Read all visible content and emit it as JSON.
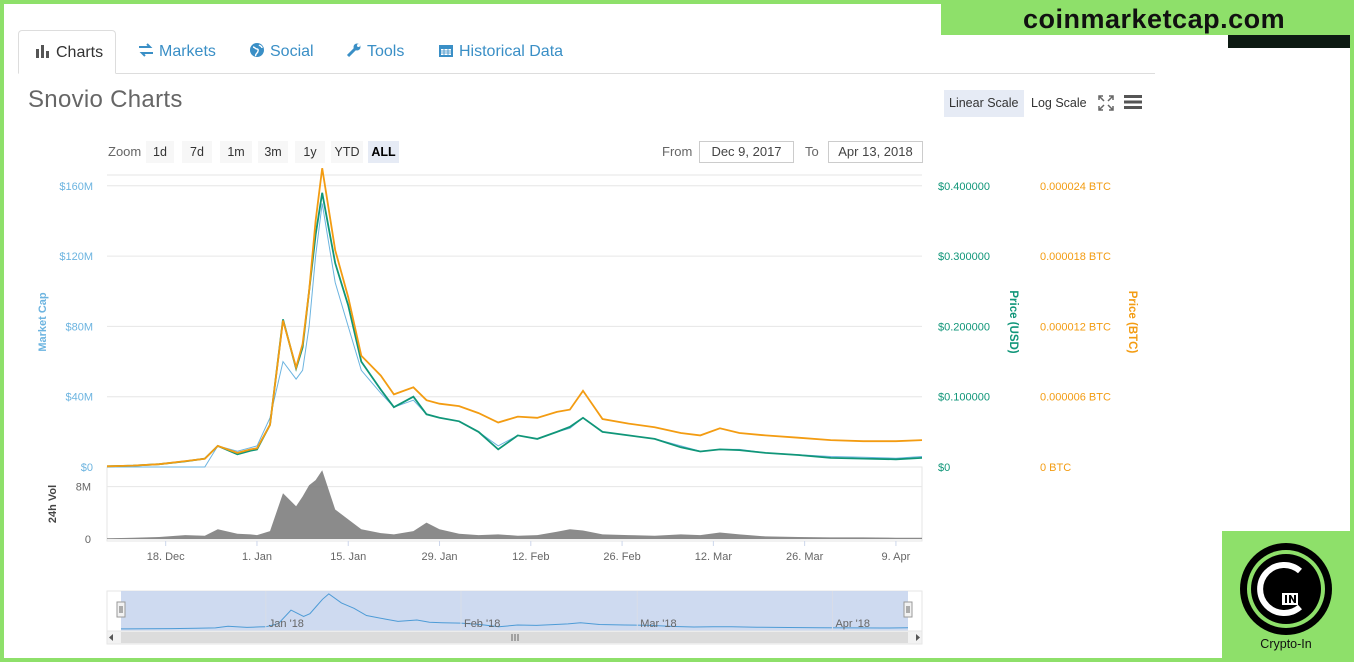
{
  "tabs": [
    {
      "label": "Charts",
      "icon": "bar-chart-icon",
      "active": true
    },
    {
      "label": "Markets",
      "icon": "exchange-arrows-icon",
      "active": false
    },
    {
      "label": "Social",
      "icon": "globe-icon",
      "active": false
    },
    {
      "label": "Tools",
      "icon": "wrench-icon",
      "active": false
    },
    {
      "label": "Historical Data",
      "icon": "calendar-icon",
      "active": false
    }
  ],
  "title": "Snovio Charts",
  "scale": {
    "linear_label": "Linear Scale",
    "log_label": "Log Scale",
    "selected": "linear"
  },
  "zoom": {
    "label": "Zoom",
    "buttons": [
      "1d",
      "7d",
      "1m",
      "3m",
      "1y",
      "YTD",
      "ALL"
    ],
    "selected": "ALL"
  },
  "range": {
    "from_label": "From",
    "from_value": "Dec 9, 2017",
    "to_label": "To",
    "to_value": "Apr 13, 2018"
  },
  "watermark": {
    "site": "coinmarketcap.com",
    "logo_caption": "Crypto-In"
  },
  "colors": {
    "market_cap": "#6cb4e0",
    "price_usd": "#109679",
    "price_btc": "#f39c12",
    "volume": "#777777",
    "navigator_fill": "#c9d6ee",
    "banner": "#8ee06a"
  },
  "chart_data": {
    "type": "line",
    "x": [
      "2017-12-09",
      "2017-12-13",
      "2017-12-17",
      "2017-12-21",
      "2017-12-24",
      "2017-12-26",
      "2017-12-29",
      "2017-12-31",
      "2018-01-01",
      "2018-01-03",
      "2018-01-05",
      "2018-01-07",
      "2018-01-08",
      "2018-01-09",
      "2018-01-10",
      "2018-01-11",
      "2018-01-13",
      "2018-01-15",
      "2018-01-17",
      "2018-01-20",
      "2018-01-22",
      "2018-01-25",
      "2018-01-27",
      "2018-01-29",
      "2018-02-01",
      "2018-02-04",
      "2018-02-07",
      "2018-02-10",
      "2018-02-13",
      "2018-02-16",
      "2018-02-18",
      "2018-02-20",
      "2018-02-23",
      "2018-02-27",
      "2018-03-03",
      "2018-03-07",
      "2018-03-10",
      "2018-03-13",
      "2018-03-16",
      "2018-03-20",
      "2018-03-25",
      "2018-03-30",
      "2018-04-04",
      "2018-04-09",
      "2018-04-13"
    ],
    "series": [
      {
        "name": "Price (USD)",
        "axis": "right-usd",
        "values": [
          0.001,
          0.002,
          0.004,
          0.008,
          0.012,
          0.03,
          0.018,
          0.023,
          0.025,
          0.06,
          0.21,
          0.14,
          0.17,
          0.25,
          0.33,
          0.39,
          0.29,
          0.23,
          0.15,
          0.11,
          0.085,
          0.1,
          0.075,
          0.07,
          0.065,
          0.05,
          0.025,
          0.045,
          0.04,
          0.05,
          0.057,
          0.07,
          0.05,
          0.045,
          0.04,
          0.028,
          0.022,
          0.025,
          0.024,
          0.02,
          0.017,
          0.013,
          0.012,
          0.011,
          0.013
        ]
      },
      {
        "name": "Price (BTC)",
        "axis": "right-btc",
        "values": [
          6e-08,
          1.2e-07,
          2.4e-07,
          5e-07,
          7e-07,
          1.8e-06,
          1.2e-06,
          1.5e-06,
          1.6e-06,
          3.6e-06,
          1.25e-05,
          8.5e-06,
          1.05e-05,
          1.5e-05,
          2.1e-05,
          2.55e-05,
          1.85e-05,
          1.45e-05,
          9.5e-06,
          7.8e-06,
          6.2e-06,
          6.8e-06,
          5.7e-06,
          5.4e-06,
          5.2e-06,
          4.6e-06,
          3.8e-06,
          4.3e-06,
          4.2e-06,
          4.7e-06,
          4.9e-06,
          6.5e-06,
          4.1e-06,
          3.7e-06,
          3.4e-06,
          2.9e-06,
          2.7e-06,
          3.3e-06,
          2.9e-06,
          2.7e-06,
          2.5e-06,
          2.3e-06,
          2.2e-06,
          2.2e-06,
          2.3e-06
        ]
      },
      {
        "name": "Market Cap",
        "axis": "left",
        "values": [
          0,
          0,
          0,
          0,
          0,
          12000000,
          9000000,
          11000000,
          12000000,
          28000000,
          60000000,
          50000000,
          55000000,
          80000000,
          120000000,
          150000000,
          105000000,
          80000000,
          55000000,
          42000000,
          34000000,
          38000000,
          30000000,
          28000000,
          26000000,
          20000000,
          12000000,
          18000000,
          16000000,
          20000000,
          22000000,
          28000000,
          20000000,
          18000000,
          16000000,
          12000000,
          9000000,
          10000000,
          10000000,
          8000000,
          7000000,
          6000000,
          5500000,
          5000000,
          6000000
        ]
      }
    ],
    "volume": {
      "name": "24h Vol",
      "values": [
        100000,
        200000,
        300000,
        600000,
        500000,
        1500000,
        800000,
        700000,
        600000,
        1200000,
        7000000,
        5000000,
        6500000,
        8200000,
        9000000,
        10500000,
        4500000,
        3000000,
        1500000,
        900000,
        700000,
        1200000,
        2500000,
        1500000,
        800000,
        600000,
        700000,
        500000,
        600000,
        1100000,
        1500000,
        1300000,
        700000,
        600000,
        500000,
        700000,
        600000,
        1000000,
        700000,
        400000,
        300000,
        250000,
        250000,
        200000,
        200000
      ]
    },
    "yaxis_left": {
      "label": "Market Cap",
      "ticks": [
        "$0",
        "$40M",
        "$80M",
        "$120M",
        "$160M"
      ],
      "range": [
        0,
        200000000
      ]
    },
    "yaxis_right_usd": {
      "label": "Price (USD)",
      "ticks": [
        "$0",
        "$0.100000",
        "$0.200000",
        "$0.300000",
        "$0.400000"
      ],
      "range": [
        0,
        0.5
      ]
    },
    "yaxis_right_btc": {
      "label": "Price (BTC)",
      "ticks": [
        "0 BTC",
        "0.000006 BTC",
        "0.000012 BTC",
        "0.000018 BTC",
        "0.000024 BTC"
      ],
      "range": [
        0,
        3e-05
      ]
    },
    "volume_axis": {
      "label": "24h Vol",
      "ticks": [
        "0",
        "8M"
      ],
      "range": [
        0,
        11000000
      ]
    },
    "xaxis_ticks": [
      {
        "date": "2017-12-18",
        "label": "18. Dec"
      },
      {
        "date": "2018-01-01",
        "label": "1. Jan"
      },
      {
        "date": "2018-01-15",
        "label": "15. Jan"
      },
      {
        "date": "2018-01-29",
        "label": "29. Jan"
      },
      {
        "date": "2018-02-12",
        "label": "12. Feb"
      },
      {
        "date": "2018-02-26",
        "label": "26. Feb"
      },
      {
        "date": "2018-03-12",
        "label": "12. Mar"
      },
      {
        "date": "2018-03-26",
        "label": "26. Mar"
      },
      {
        "date": "2018-04-09",
        "label": "9. Apr"
      }
    ],
    "navigator_ticks": [
      {
        "date": "2018-01-01",
        "label": "Jan '18"
      },
      {
        "date": "2018-02-01",
        "label": "Feb '18"
      },
      {
        "date": "2018-03-01",
        "label": "Mar '18"
      },
      {
        "date": "2018-04-01",
        "label": "Apr '18"
      }
    ],
    "grid": true,
    "xlim": [
      "2017-12-09",
      "2018-04-13"
    ]
  }
}
